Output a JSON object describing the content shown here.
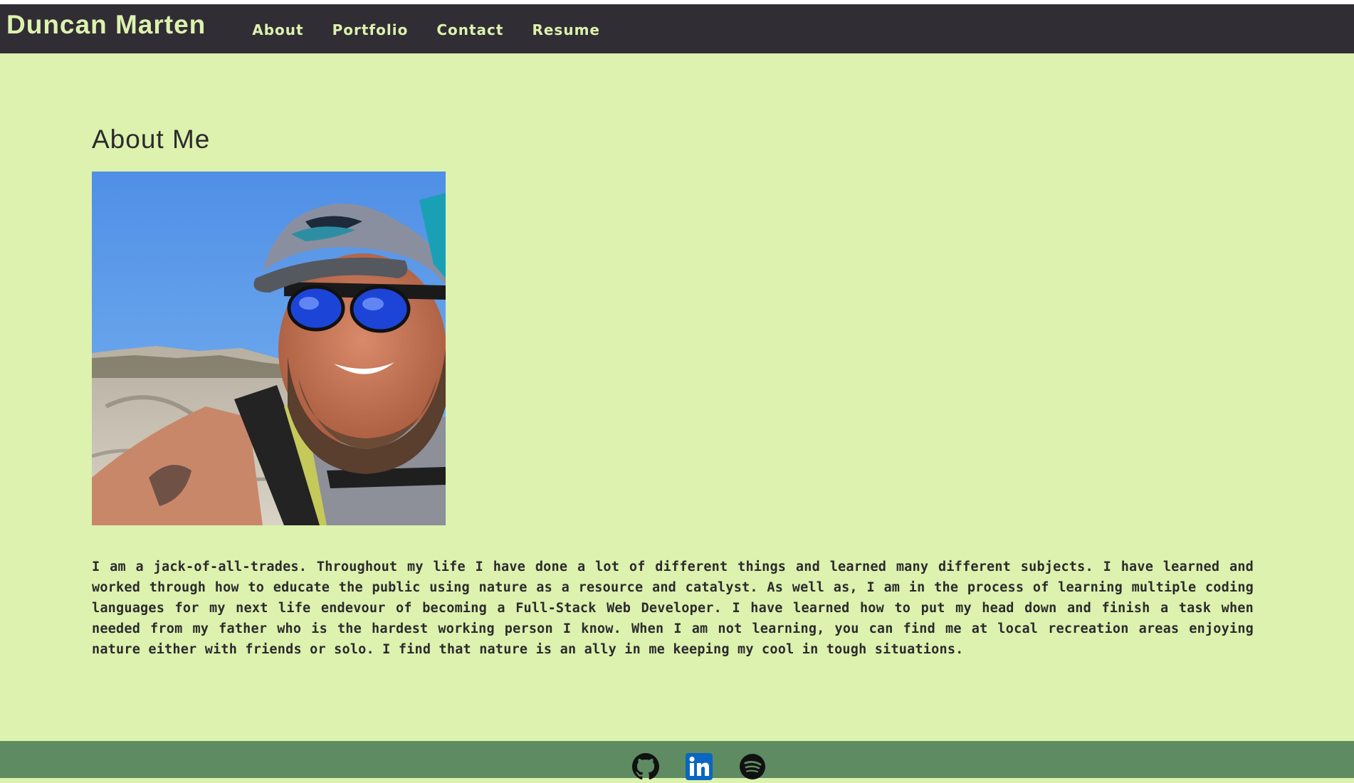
{
  "header": {
    "brand": "Duncan Marten",
    "nav": [
      {
        "label": "About"
      },
      {
        "label": "Portfolio"
      },
      {
        "label": "Contact"
      },
      {
        "label": "Resume"
      }
    ]
  },
  "about": {
    "title": "About Me",
    "photo_icon": "portrait-photo",
    "bio": "I am a jack-of-all-trades. Throughout my life I have done a lot of different things and learned many different subjects. I have learned and worked through how to educate the public using nature as a resource and catalyst. As well as, I am in the process of learning multiple coding languages for my next life endevour of becoming a Full-Stack Web Developer. I have learned how to put my head down and finish a task when needed from my father who is the hardest working person I know. When I am not learning, you can find me at local recreation areas enjoying nature either with friends or solo. I find that nature is an ally in me keeping my cool in tough situations."
  },
  "footer": {
    "social": [
      {
        "icon": "github-icon"
      },
      {
        "icon": "linkedin-icon"
      },
      {
        "icon": "spotify-icon"
      }
    ]
  },
  "colors": {
    "background": "#dcf2ae",
    "navbar": "#312d35",
    "accent_text": "#dcf2ae",
    "footer": "#5e8b62",
    "linkedin": "#0a66c2"
  }
}
